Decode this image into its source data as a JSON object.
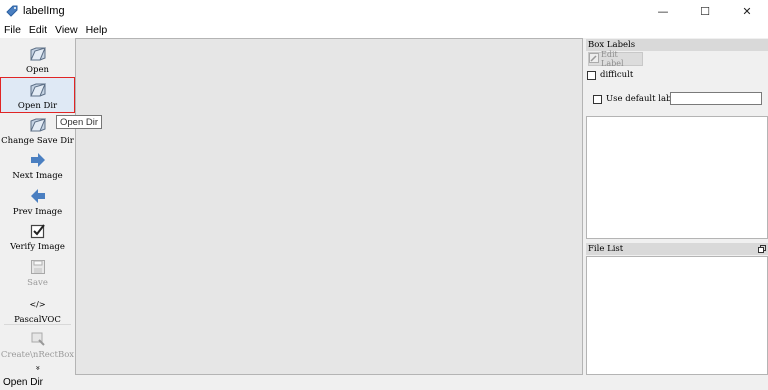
{
  "window": {
    "title": "labelImg",
    "controls": {
      "minimize": "—",
      "maximize": "☐",
      "close": "✕"
    }
  },
  "menu": [
    "File",
    "Edit",
    "View",
    "Help"
  ],
  "toolbar": {
    "open": "Open",
    "open_dir": "Open Dir",
    "change_save_dir": "Change Save Dir",
    "next_image": "Next Image",
    "prev_image": "Prev Image",
    "verify_image": "Verify Image",
    "save": "Save",
    "format_icon": "</>",
    "format": "PascalVOC",
    "create_rectbox": "Create\\nRectBox",
    "more": "»"
  },
  "tooltip": "Open Dir",
  "box_labels": {
    "title": "Box Labels",
    "edit_label": "Edit Label",
    "difficult": "difficult",
    "use_default_label": "Use default label",
    "default_label_value": ""
  },
  "file_list": {
    "title": "File List"
  },
  "status": "Open Dir",
  "colors": {
    "selection_border": "#e02525",
    "canvas": "#e6e6e6",
    "arrow_blue": "#4a7fc1"
  }
}
